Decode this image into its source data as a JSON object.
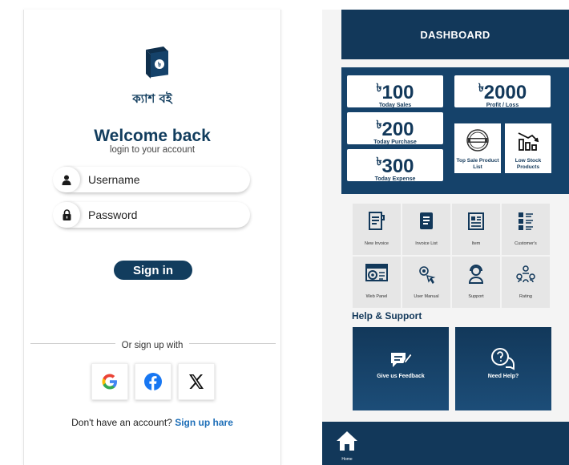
{
  "login": {
    "brand_name": "ক্যাশ বই",
    "welcome": "Welcome back",
    "subtitle": "login to your account",
    "username_placeholder": "Username",
    "password_placeholder": "Password",
    "signin_label": "Sign in",
    "or_signup": "Or sign up with",
    "social": [
      {
        "name": "google",
        "icon": "google-icon"
      },
      {
        "name": "facebook",
        "icon": "facebook-icon"
      },
      {
        "name": "x",
        "icon": "x-icon"
      }
    ],
    "no_account": "Don't have an account?",
    "signup_link": "Sign up hare"
  },
  "dashboard": {
    "title": "DASHBOARD",
    "currency": "৳",
    "stats": {
      "sales": {
        "value": "100",
        "label": "Today Sales"
      },
      "purchase": {
        "value": "200",
        "label": "Today Purchase"
      },
      "expense": {
        "value": "300",
        "label": "Today Expense"
      },
      "profit": {
        "value": "2000",
        "label": "Profit / Loss"
      }
    },
    "tiles": {
      "top_sale": "Top Sale Product List",
      "low_stock": "Low Stock Products"
    },
    "menu": [
      {
        "label": "New Invoice",
        "icon": "new-invoice-icon"
      },
      {
        "label": "Invoice List",
        "icon": "invoice-list-icon"
      },
      {
        "label": "Item",
        "icon": "item-icon"
      },
      {
        "label": "Customer's",
        "icon": "customers-icon"
      },
      {
        "label": "Web Panel",
        "icon": "web-panel-icon"
      },
      {
        "label": "User Manual",
        "icon": "user-manual-icon"
      },
      {
        "label": "Support",
        "icon": "support-icon"
      },
      {
        "label": "Rating",
        "icon": "rating-icon"
      }
    ],
    "help_title": "Help & Support",
    "help": {
      "feedback": "Give us Feedback",
      "need_help": "Need Help?"
    },
    "nav": {
      "home": "Home"
    }
  },
  "colors": {
    "primary": "#12385a",
    "link": "#1e6fb8",
    "tile_bg": "#e6e6e6"
  }
}
